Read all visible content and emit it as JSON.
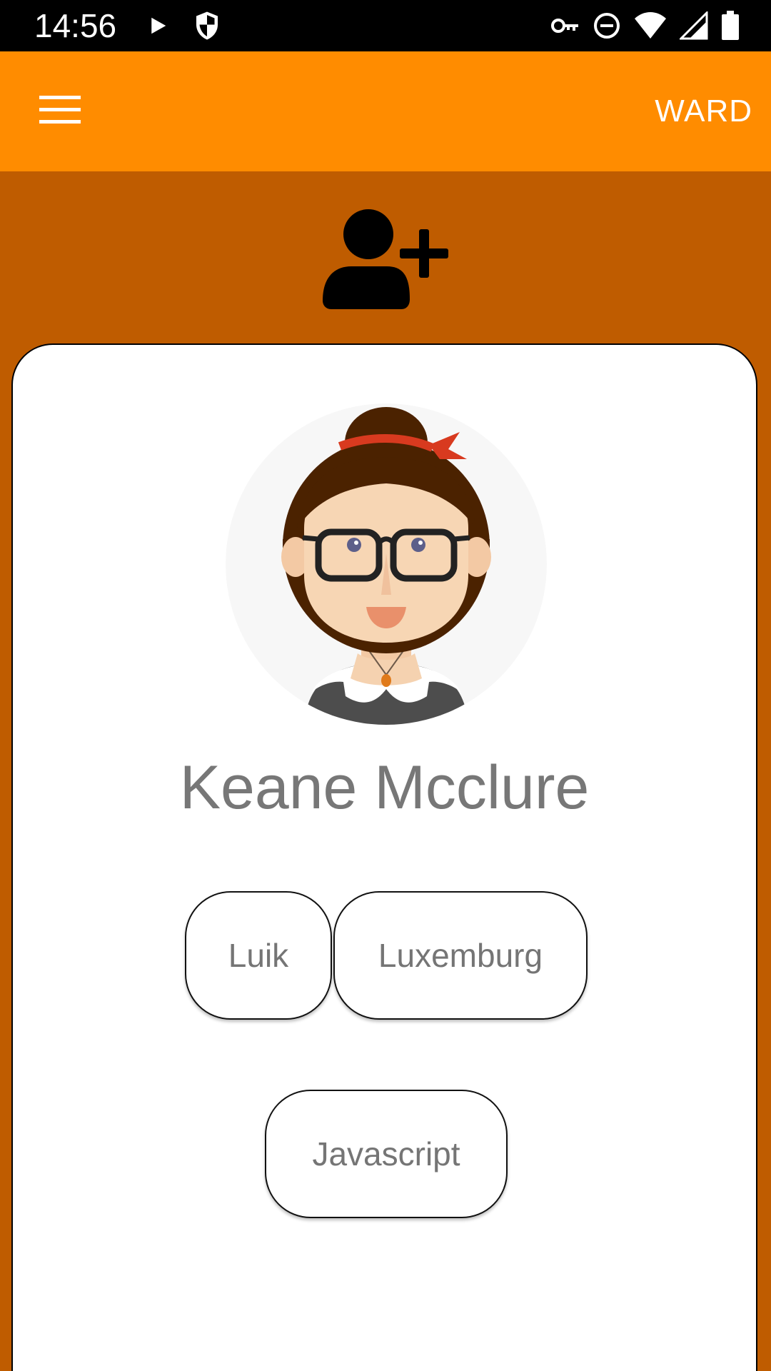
{
  "status_bar": {
    "time": "14:56",
    "left_icons": [
      "play-icon",
      "shield-icon"
    ],
    "right_icons": [
      "vpn-key-icon",
      "do-not-disturb-icon",
      "wifi-icon",
      "cellular-signal-icon",
      "battery-icon"
    ]
  },
  "app_bar": {
    "menu_icon": "hamburger-menu-icon",
    "action_label": "WARD",
    "color": "#ff8c00"
  },
  "main": {
    "background_color": "#bf5c00",
    "add_user_icon": "add-user-icon"
  },
  "profile": {
    "avatar": "woman-avatar-illustration",
    "name": "Keane Mcclure",
    "chips": [
      "Luik",
      "Luxemburg",
      "Javascript"
    ]
  }
}
